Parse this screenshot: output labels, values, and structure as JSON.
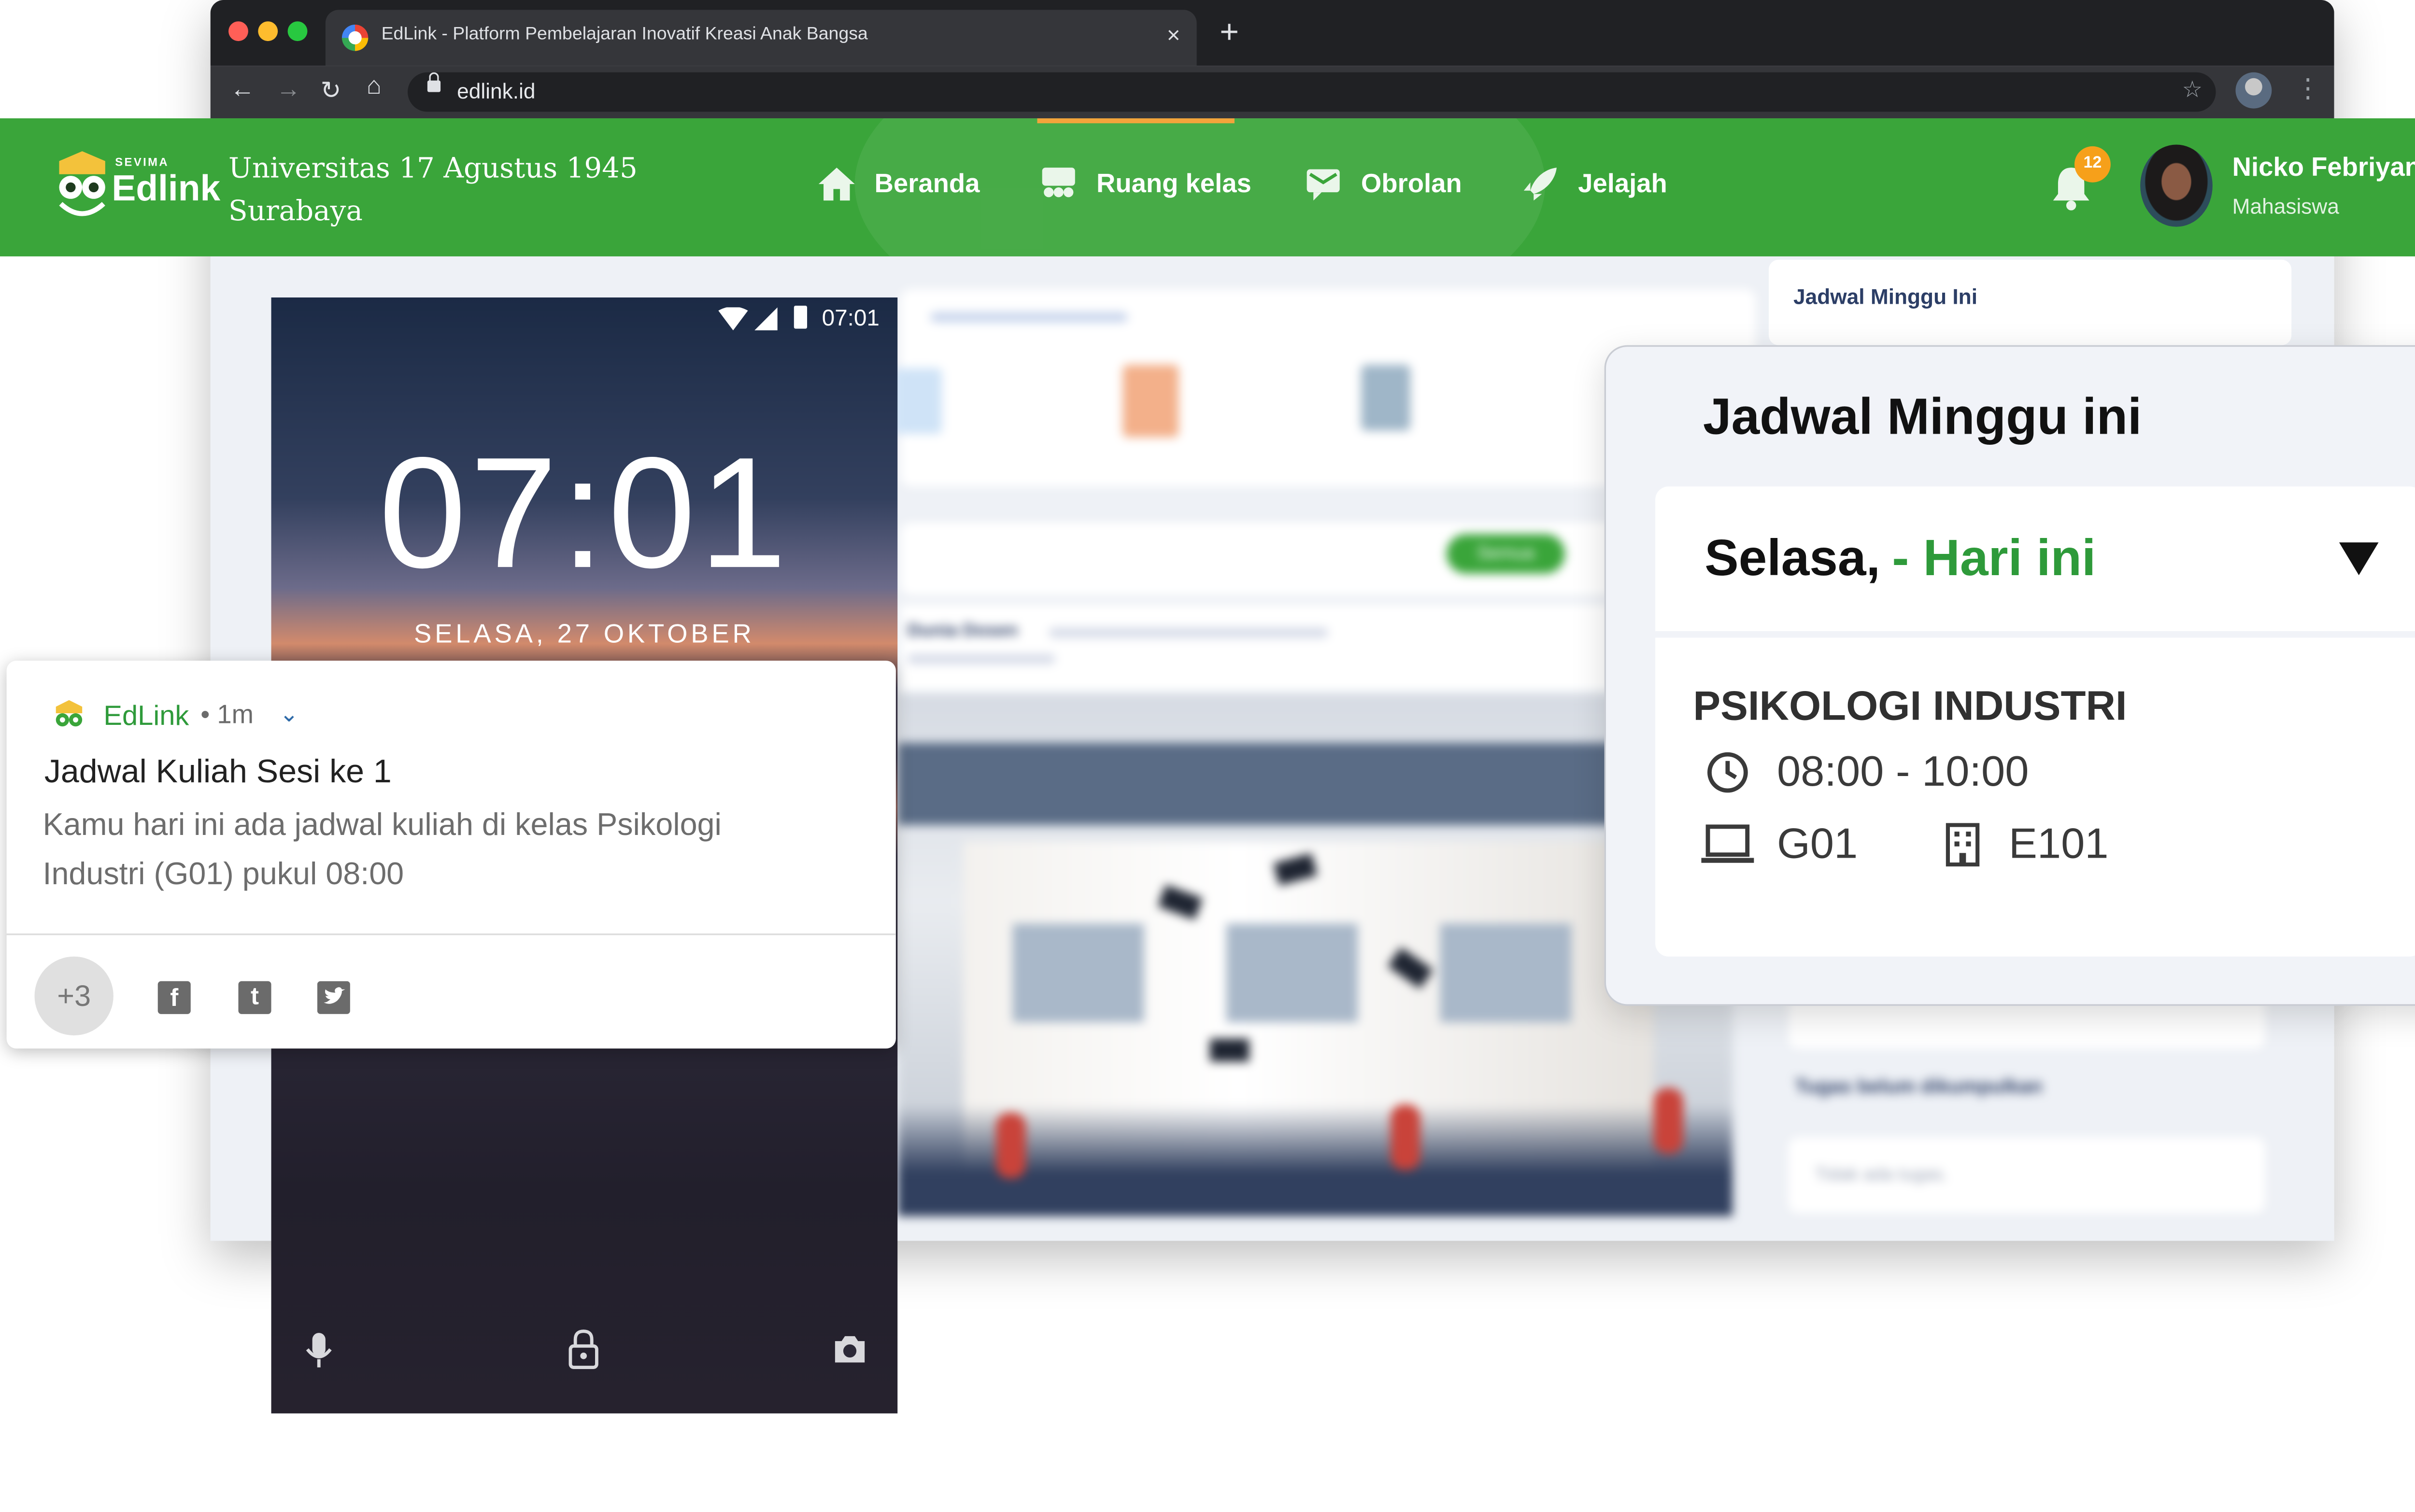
{
  "browser": {
    "tab_title": "EdLink - Platform Pembelajaran Inovatif Kreasi Anak Bangsa",
    "url": "edlink.id",
    "tab_close": "×",
    "new_tab": "+"
  },
  "app": {
    "brand_top": "SEVIMA",
    "brand": "Edlink",
    "university_line1": "Universitas 17 Agustus 1945",
    "university_line2": "Surabaya",
    "nav": [
      {
        "label": "Beranda",
        "icon": "home-icon"
      },
      {
        "label": "Ruang kelas",
        "icon": "classroom-icon"
      },
      {
        "label": "Obrolan",
        "icon": "chat-icon"
      },
      {
        "label": "Jelajah",
        "icon": "rocket-icon"
      }
    ],
    "notification_count": "12",
    "user_name": "Nicko Febriyanto",
    "user_role": "Mahasiswa",
    "accent": "#3aa53a"
  },
  "background_page": {
    "sidebar_title": "Jadwal Minggu Ini",
    "panel_hint": "Tugas belum dikumpulkan",
    "panel_empty": "Tidak ada tugas.",
    "post_author": "Dunia Dosen",
    "chip": "Semua"
  },
  "phone": {
    "status_time": "07:01",
    "clock": "07:01",
    "date": "SELASA, 27 OKTOBER"
  },
  "notification": {
    "app_name": "EdLink",
    "time": "• 1m",
    "title": "Jadwal Kuliah Sesi ke 1",
    "body": "Kamu hari ini ada jadwal kuliah di kelas Psikologi Industri (G01) pukul 08:00",
    "more_count": "+3"
  },
  "schedule": {
    "title": "Jadwal Minggu ini",
    "day": "Selasa,",
    "today": "- Hari ini",
    "course": "PSIKOLOGI INDUSTRI",
    "time": "08:00 - 10:00",
    "class": "G01",
    "room": "E101"
  }
}
